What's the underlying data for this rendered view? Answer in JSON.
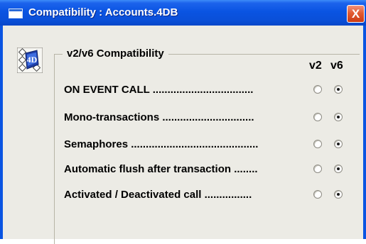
{
  "window": {
    "title": "Compatibility : Accounts.4DB",
    "close_glyph": "X",
    "accent": "#0a54e2"
  },
  "group": {
    "title": "v2/v6 Compatibility",
    "icon": "4d-database-icon",
    "columns": {
      "v2": "v2",
      "v6": "v6"
    },
    "options": [
      {
        "label": "ON EVENT CALL ..................................",
        "selected": "v6"
      },
      {
        "label": "Mono-transactions ...............................",
        "selected": "v6"
      },
      {
        "label": "Semaphores ...........................................",
        "selected": "v6"
      },
      {
        "label": "Automatic flush after transaction ........",
        "selected": "v6"
      },
      {
        "label": "Activated / Deactivated call ................",
        "selected": "v6"
      }
    ]
  }
}
